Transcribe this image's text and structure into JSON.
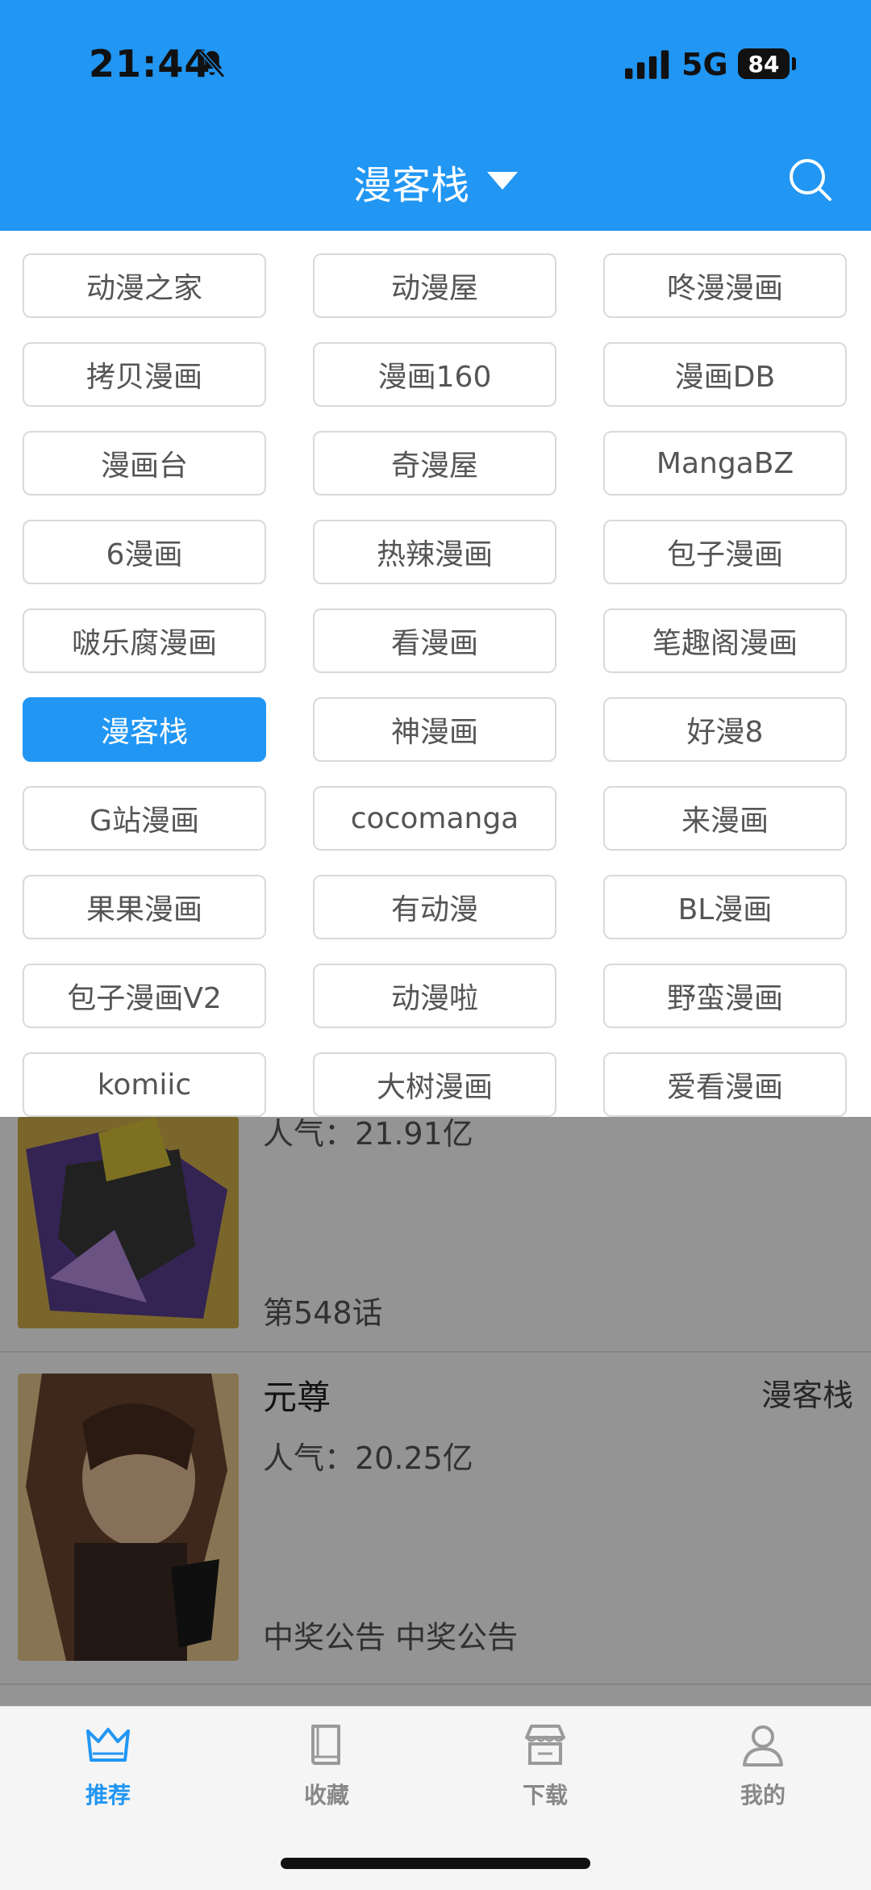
{
  "status": {
    "time": "21:44",
    "network": "5G",
    "battery": "84"
  },
  "header": {
    "title": "漫客栈"
  },
  "sources": {
    "selected": "漫客栈",
    "items": [
      "动漫之家",
      "动漫屋",
      "咚漫漫画",
      "拷贝漫画",
      "漫画160",
      "漫画DB",
      "漫画台",
      "奇漫屋",
      "MangaBZ",
      "6漫画",
      "热辣漫画",
      "包子漫画",
      "啵乐腐漫画",
      "看漫画",
      "笔趣阁漫画",
      "漫客栈",
      "神漫画",
      "好漫8",
      "G站漫画",
      "cocomanga",
      "来漫画",
      "果果漫画",
      "有动漫",
      "BL漫画",
      "包子漫画V2",
      "动漫啦",
      "野蛮漫画",
      "komiic",
      "大树漫画",
      "爱看漫画"
    ]
  },
  "list": {
    "items": [
      {
        "popularity": "人气：21.91亿",
        "update": "第548话"
      },
      {
        "title": "元尊",
        "source": "漫客栈",
        "popularity": "人气：20.25亿",
        "update": "中奖公告 中奖公告"
      }
    ]
  },
  "tabbar": {
    "tabs": [
      {
        "label": "推荐",
        "icon": "crown-icon",
        "active": true
      },
      {
        "label": "收藏",
        "icon": "book-icon",
        "active": false
      },
      {
        "label": "下载",
        "icon": "store-icon",
        "active": false
      },
      {
        "label": "我的",
        "icon": "user-icon",
        "active": false
      }
    ]
  },
  "colors": {
    "accent": "#2196f3"
  }
}
